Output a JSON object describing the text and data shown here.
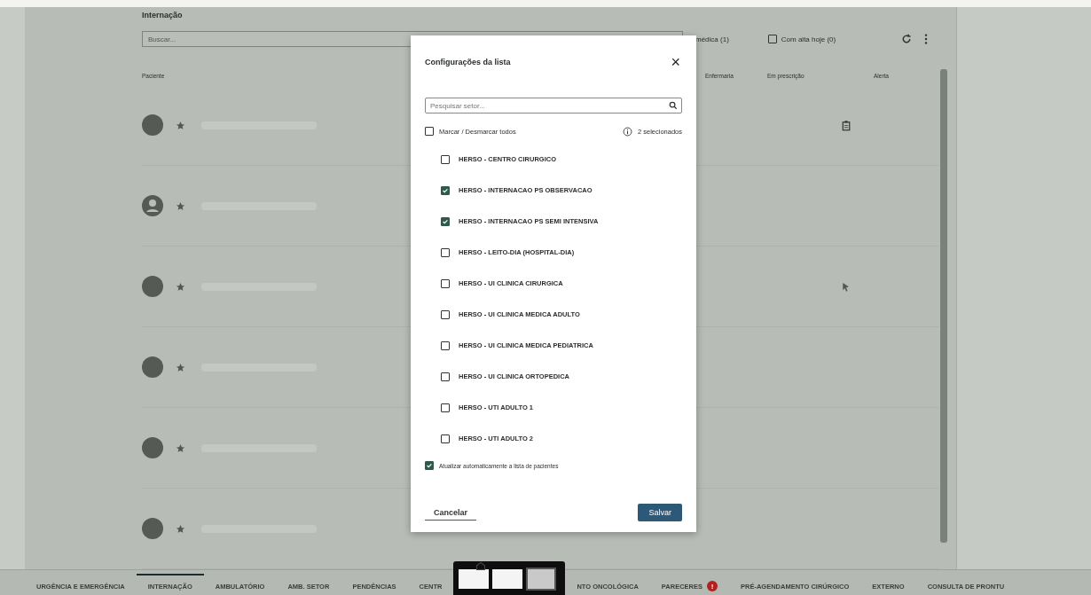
{
  "page": {
    "title": "Internação",
    "search": {
      "placeholder": "Buscar..."
    },
    "filter_partial": "médica (1)",
    "discharge_filter": {
      "label": "Com alta hoje (0)",
      "checked": false
    }
  },
  "table": {
    "columns": [
      "Paciente",
      "Enfermaria",
      "Em prescrição",
      "Alerta"
    ],
    "rows": [
      {
        "avatar": {
          "kind": "filled"
        },
        "status": {
          "kind": "clipboard"
        }
      },
      {
        "avatar": {
          "kind": "person"
        }
      },
      {
        "avatar": {
          "kind": "filled"
        },
        "status": {
          "kind": "pointer"
        }
      },
      {
        "avatar": {
          "kind": "filled"
        }
      },
      {
        "avatar": {
          "kind": "filled"
        }
      },
      {
        "avatar": {
          "kind": "filled"
        }
      }
    ]
  },
  "dialog": {
    "title": "Configurações da lista",
    "close": "×",
    "search": {
      "placeholder": "Pesquisar setor..."
    },
    "toggle_all": {
      "label": "Marcar / Desmarcar todos",
      "checked": false
    },
    "selected_count": "2 selecionados",
    "sectors": [
      {
        "label": "HERSO - CENTRO CIRURGICO",
        "checked": false
      },
      {
        "label": "HERSO - INTERNACAO PS OBSERVACAO",
        "checked": true
      },
      {
        "label": "HERSO - INTERNACAO PS SEMI INTENSIVA",
        "checked": true
      },
      {
        "label": "HERSO - LEITO-DIA (HOSPITAL-DIA)",
        "checked": false
      },
      {
        "label": "HERSO - UI CLINICA CIRURGICA",
        "checked": false
      },
      {
        "label": "HERSO - UI CLINICA MEDICA ADULTO",
        "checked": false
      },
      {
        "label": "HERSO - UI CLINICA MEDICA PEDIATRICA",
        "checked": false
      },
      {
        "label": "HERSO - UI CLINICA ORTOPEDICA",
        "checked": false
      },
      {
        "label": "HERSO - UTI ADULTO 1",
        "checked": false
      },
      {
        "label": "HERSO - UTI ADULTO 2",
        "checked": false
      }
    ],
    "auto_refresh": {
      "label": "Atualizar automaticamente a lista de pacientes",
      "checked": true
    },
    "buttons": [
      "Cancelar",
      "Salvar"
    ]
  },
  "bottom_tabs": [
    {
      "kind": "tab",
      "label": "URGÊNCIA E EMERGÊNCIA",
      "selected": false
    },
    {
      "kind": "tab",
      "label": "INTERNAÇÃO",
      "selected": true
    },
    {
      "kind": "tab",
      "label": "AMBULATÓRIO",
      "selected": false
    },
    {
      "kind": "tab",
      "label": "AMB. SETOR",
      "selected": false
    },
    {
      "kind": "tab",
      "label": "PENDÊNCIAS",
      "selected": false
    },
    {
      "kind": "tab",
      "label": "CENTR",
      "selected": false
    },
    {
      "kind": "preview"
    },
    {
      "kind": "tab",
      "label": "NTO ONCOLÓGICA",
      "selected": false
    },
    {
      "kind": "tab",
      "label": "PARECERES",
      "selected": false,
      "badge": "!"
    },
    {
      "kind": "tab",
      "label": "PRÉ-AGENDAMENTO CIRÚRGICO",
      "selected": false
    },
    {
      "kind": "tab",
      "label": "EXTERNO",
      "selected": false
    },
    {
      "kind": "tab",
      "label": "CONSULTA DE PRONTU",
      "selected": false
    }
  ]
}
